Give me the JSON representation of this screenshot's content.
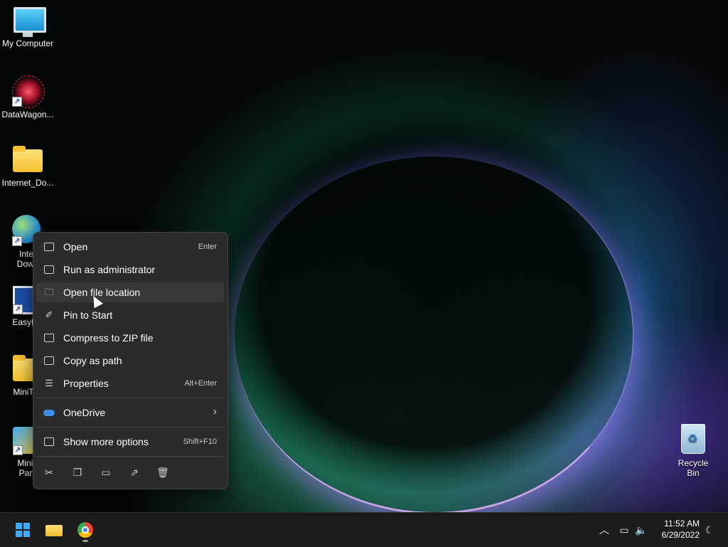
{
  "desktop": {
    "icons": [
      {
        "label": "My Computer"
      },
      {
        "label": "DataWagon..."
      },
      {
        "label": "Internet_Do..."
      },
      {
        "label": "Inter\nDown"
      },
      {
        "label": "EasyBC"
      },
      {
        "label": "MiniToo"
      },
      {
        "label": "MiniT\nParti"
      }
    ],
    "recycle_bin": {
      "label": "Recycle Bin"
    }
  },
  "context_menu": {
    "items": [
      {
        "label": "Open",
        "shortcut": "Enter",
        "icon": "open-icon"
      },
      {
        "label": "Run as administrator",
        "shortcut": "",
        "icon": "shield-icon"
      },
      {
        "label": "Open file location",
        "shortcut": "",
        "icon": "folder-icon"
      },
      {
        "label": "Pin to Start",
        "shortcut": "",
        "icon": "pin-icon"
      },
      {
        "label": "Compress to ZIP file",
        "shortcut": "",
        "icon": "zip-icon"
      },
      {
        "label": "Copy as path",
        "shortcut": "",
        "icon": "path-icon"
      },
      {
        "label": "Properties",
        "shortcut": "Alt+Enter",
        "icon": "properties-icon"
      },
      {
        "label": "OneDrive",
        "shortcut": "",
        "icon": "onedrive-icon"
      },
      {
        "label": "Show more options",
        "shortcut": "Shift+F10",
        "icon": "more-options-icon"
      }
    ],
    "actions": [
      {
        "icon": "cut-icon",
        "glyph": "✂"
      },
      {
        "icon": "copy-icon",
        "glyph": "❐"
      },
      {
        "icon": "rename-icon",
        "glyph": "▭"
      },
      {
        "icon": "share-icon",
        "glyph": "⇗"
      },
      {
        "icon": "delete-icon",
        "glyph": "🗑"
      }
    ],
    "onedrive_arrow": "›"
  },
  "taskbar": {
    "tray_chevron": "︿",
    "clock": {
      "time": "11:52 AM",
      "date": "6/29/2022"
    }
  }
}
